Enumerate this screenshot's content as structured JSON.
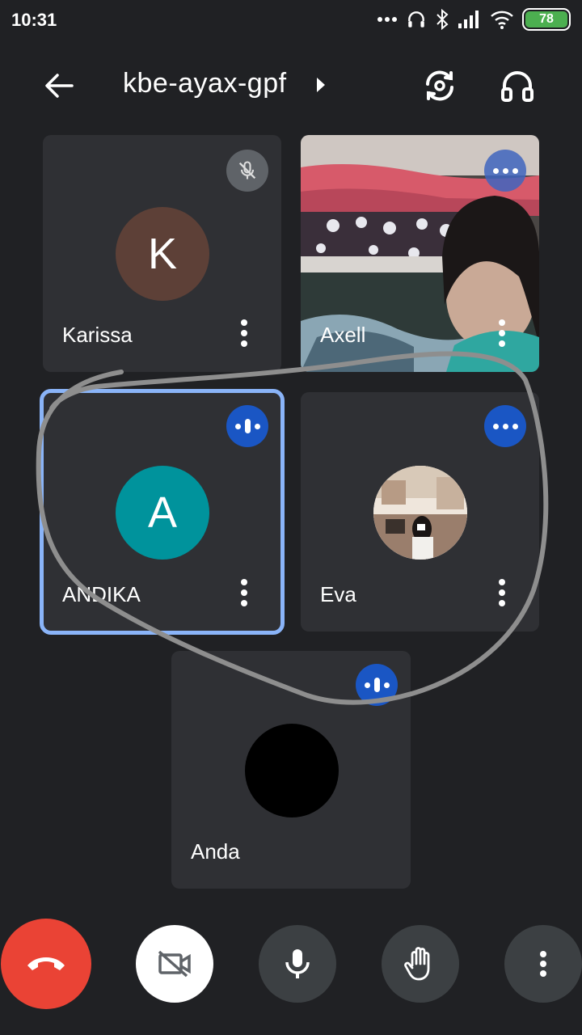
{
  "status_bar": {
    "time": "10:31",
    "battery_level": "78",
    "icons": [
      "more-dots-icon",
      "headset-icon",
      "bluetooth-icon",
      "signal-icon",
      "wifi-icon",
      "battery-icon"
    ]
  },
  "header": {
    "meeting_code": "kbe-ayax-gpf",
    "back_icon": "arrow-back-icon",
    "switch_camera_icon": "switch-camera-icon",
    "audio_output_icon": "headphones-icon"
  },
  "participants": [
    {
      "name": "Karissa",
      "initial": "K",
      "avatar_color": "#5d4037",
      "state": "muted"
    },
    {
      "name": "Axell",
      "state": "video",
      "speaking": true
    },
    {
      "name": "ANDIKA",
      "initial": "A",
      "avatar_color": "#00939c",
      "state": "speaking",
      "highlighted": true
    },
    {
      "name": "Eva",
      "state": "speaking",
      "avatar": "photo"
    },
    {
      "name": "Anda",
      "state": "speaking",
      "avatar": "black"
    }
  ],
  "controls": {
    "end_call_icon": "call-end-icon",
    "camera_icon": "videocam-off-icon",
    "mic_icon": "mic-icon",
    "raise_hand_icon": "raise-hand-icon",
    "more_icon": "more-vert-icon"
  },
  "colors": {
    "background": "#202124",
    "tile": "#2f3034",
    "speaking_badge": "#1a56c4",
    "highlight_border": "#8ab4f8",
    "end_call": "#ea4335"
  }
}
